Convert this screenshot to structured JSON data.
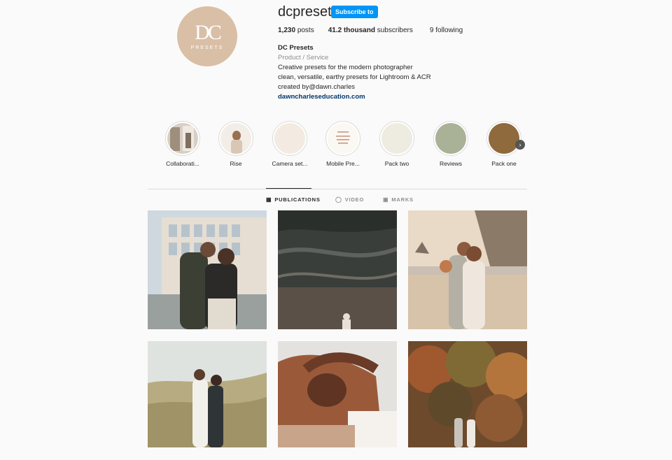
{
  "profile": {
    "username": "dcpresets",
    "follow_label": "Subscribe to",
    "avatar": {
      "mark": "DC",
      "sub": "PRESETS",
      "color": "#d9bfa6"
    },
    "stats": {
      "posts_count": "1,230",
      "posts_label": "posts",
      "subscribers_count": "41.2 thousand",
      "subscribers_label": "subscribers",
      "following_count": "9",
      "following_label": "following"
    },
    "bio": {
      "name": "DC Presets",
      "category": "Product / Service",
      "line1": "Creative presets for the modern photographer",
      "line2": "clean, versatile, earthy presets for Lightroom & ACR",
      "line3": "created by@dawn.charles",
      "link": "dawncharleseducation.com"
    }
  },
  "highlights": [
    {
      "label": "Collaborati...",
      "color": "#c9bfb3"
    },
    {
      "label": "Rise",
      "color": "#e8dfd5"
    },
    {
      "label": "Camera set...",
      "color": "#f3ebe2"
    },
    {
      "label": "Mobile Pre...",
      "color": "#fbf7f2"
    },
    {
      "label": "Pack two",
      "color": "#eeebe0"
    },
    {
      "label": "Reviews",
      "color": "#a9b197"
    },
    {
      "label": "Pack one",
      "color": "#8f6a3c"
    }
  ],
  "tabs": [
    {
      "label": "PUBLICATIONS",
      "icon": "grid-icon"
    },
    {
      "label": "VIDEO",
      "icon": "video-icon"
    },
    {
      "label": "MARKS",
      "icon": "tag-icon"
    }
  ],
  "colors": {
    "accent": "#0095f6",
    "link": "#00376b",
    "muted": "#8e8e8e"
  }
}
